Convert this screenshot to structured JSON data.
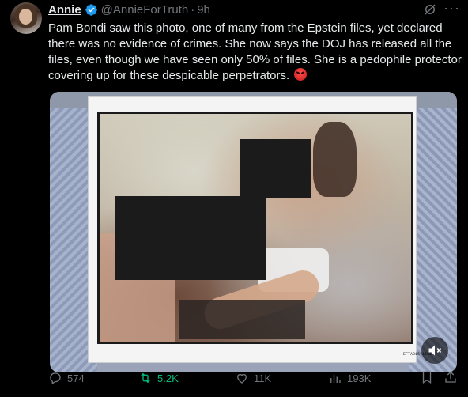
{
  "tweet": {
    "display_name": "Annie",
    "handle": "@AnnieForTruth",
    "separator": "·",
    "time": "9h",
    "text": "Pam Bondi saw this photo, one of many from the Epstein files, yet declared there was no evidence of crimes. She now says the DOJ has released all the files, even though we have seen only 50% of files. She is a pedophile protector covering up for these despicable perpetrators.",
    "emoji": "angry-face",
    "media": {
      "document_label": "EFTA01641161",
      "mute_icon": "speaker-muted-icon"
    },
    "actions": {
      "replies": "574",
      "reposts": "5.2K",
      "likes": "11K",
      "views": "193K"
    }
  },
  "colors": {
    "background": "#000000",
    "text": "#e7e9ea",
    "muted": "#71767b",
    "verified": "#1d9bf0",
    "repost": "#00ba7c"
  }
}
